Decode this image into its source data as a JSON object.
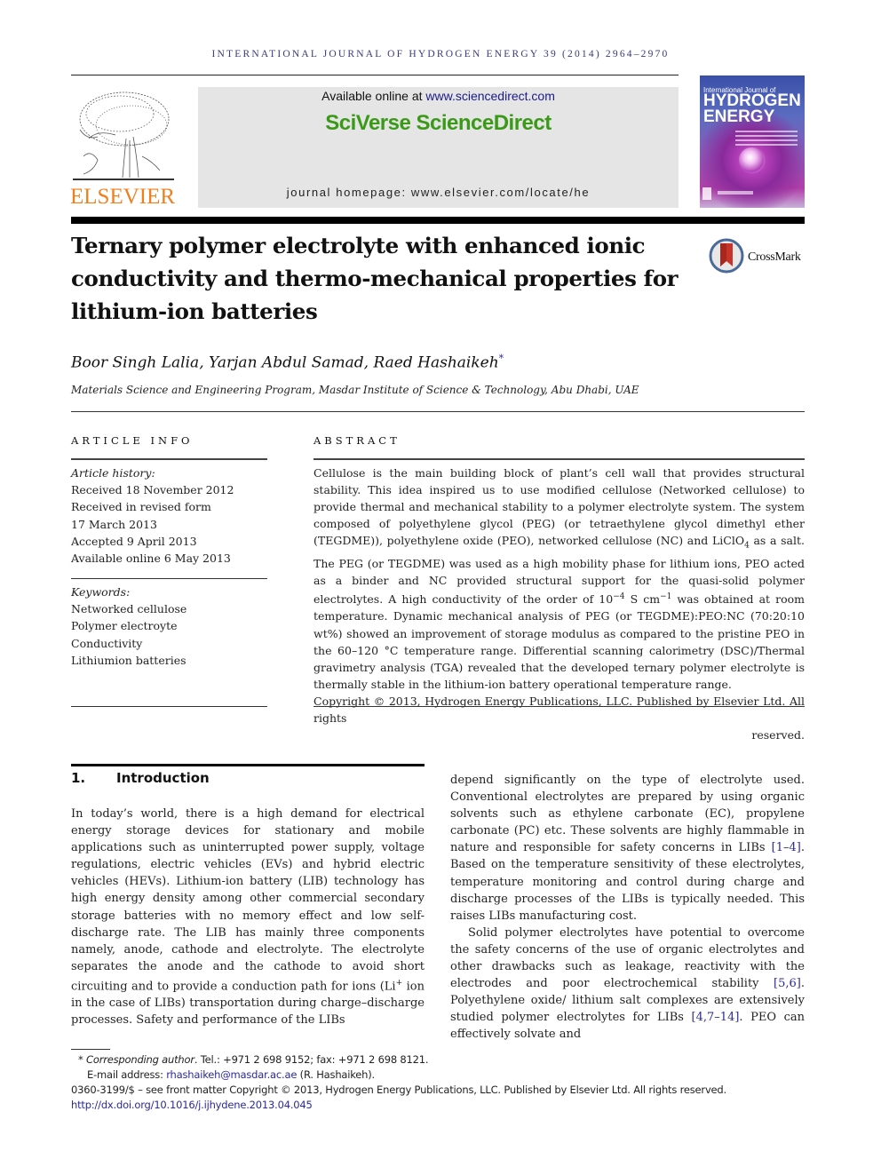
{
  "running_head": "INTERNATIONAL JOURNAL OF HYDROGEN ENERGY 39 (2014) 2964–2970",
  "publisher": {
    "name": "ELSEVIER",
    "brand_color": "#f07f1d"
  },
  "sciencedirect": {
    "available_prefix": "Available online at ",
    "available_link": "www.sciencedirect.com",
    "brand": "SciVerse ScienceDirect",
    "brand_color": "#3a9a18",
    "homepage": "journal homepage: www.elsevier.com/locate/he"
  },
  "cover": {
    "line1": "International Journal of",
    "line2": "HYDROGEN",
    "line3": "ENERGY"
  },
  "crossmark": {
    "label": "CrossMark"
  },
  "article": {
    "title": "Ternary polymer electrolyte with enhanced ionic conductivity and thermo-mechanical properties for lithium-ion batteries",
    "authors": "Boor Singh Lalia, Yarjan Abdul Samad, Raed Hashaikeh",
    "corresponding_mark": "*",
    "affiliation": "Materials Science and Engineering Program, Masdar Institute of Science & Technology, Abu Dhabi, UAE"
  },
  "article_info": {
    "heading": "ARTICLE INFO",
    "history_label": "Article history:",
    "history": [
      "Received 18 November 2012",
      "Received in revised form",
      "17 March 2013",
      "Accepted 9 April 2013",
      "Available online 6 May 2013"
    ],
    "keywords_label": "Keywords:",
    "keywords": [
      "Networked cellulose",
      "Polymer electroyte",
      "Conductivity",
      "Lithiumion batteries"
    ]
  },
  "abstract": {
    "heading": "ABSTRACT",
    "p1_a": "Cellulose is the main building block of plant’s cell wall that provides structural stability. This idea inspired us to use modified cellulose (Networked cellulose) to provide thermal and mechanical stability to a polymer electrolyte system. The system composed of polyethylene glycol (PEG) (or tetraethylene glycol dimethyl ether (TEGDME)), polyethylene oxide (PEO), networked cellulose (NC) and LiClO",
    "p1_sub": "4",
    "p1_b": " as a salt. The PEG (or TEGDME) was used as a high mobility phase for lithium ions, PEO acted as a binder and NC provided structural support for the quasi-solid polymer electrolytes. A high conductivity of the order of 10",
    "p1_sup1": "−4",
    "p1_c": " S cm",
    "p1_sup2": "−1",
    "p1_d": " was obtained at room temperature. Dynamic mechanical analysis of PEG (or TEGDME):PEO:NC (70:20:10 wt%) showed an improvement of storage modulus as compared to the pristine PEO in the 60–120 °C temperature range. Differential scanning calorimetry (DSC)/Thermal gravimetry analysis (TGA) revealed that the developed ternary polymer electrolyte is thermally stable in the lithium-ion battery operational temperature range.",
    "copyright_a": "Copyright © 2013, Hydrogen Energy Publications, LLC. Published by Elsevier Ltd. All rights",
    "copyright_b": "reserved."
  },
  "introduction": {
    "number": "1.",
    "title": "Introduction",
    "left_text": "In today’s world, there is a high demand for electrical energy storage devices for stationary and mobile applications such as uninterrupted power supply, voltage regulations, electric vehicles (EVs) and hybrid electric vehicles (HEVs). Lithium-ion battery (LIB) technology has high energy density among other commercial secondary storage batteries with no memory effect and low self-discharge rate. The LIB has mainly three components namely, anode, cathode and electrolyte. The electrolyte separates the anode and the cathode to avoid short circuiting and to provide a conduction path for ions (Li",
    "left_sup": "+",
    "left_text_b": " ion in the case of LIBs) transportation during charge–discharge processes. Safety and performance of the LIBs",
    "right_p1_a": "depend significantly on the type of electrolyte used. Conventional electrolytes are prepared by using organic solvents such as ethylene carbonate (EC), propylene carbonate (PC) etc. These solvents are highly flammable in nature and responsible for safety concerns in LIBs ",
    "right_cite1": "[1–4]",
    "right_p1_b": ". Based on the temperature sensitivity of these electrolytes, temperature monitoring and control during charge and discharge processes of the LIBs is typically needed. This raises LIBs manufacturing cost.",
    "right_p2_a": "Solid polymer electrolytes have potential to overcome the safety concerns of the use of organic electrolytes and other drawbacks such as leakage, reactivity with the electrodes and poor electrochemical stability ",
    "right_cite2": "[5,6]",
    "right_p2_b": ". Polyethylene oxide/ lithium salt complexes are extensively studied polymer electrolytes for LIBs ",
    "right_cite3": "[4,7–14]",
    "right_p2_c": ". PEO can effectively solvate and"
  },
  "footnotes": {
    "star": "*",
    "corresponding_label": "Corresponding author",
    "contact": ". Tel.: +971 2 698 9152; fax: +971 2 698 8121.",
    "email_label": "E-mail address: ",
    "email": "rhashaikeh@masdar.ac.ae",
    "email_suffix": " (R. Hashaikeh).",
    "issn_line": "0360-3199/$ – see front matter Copyright © 2013, Hydrogen Energy Publications, LLC. Published by Elsevier Ltd. All rights reserved.",
    "doi": "http://dx.doi.org/10.1016/j.ijhydene.2013.04.045"
  }
}
